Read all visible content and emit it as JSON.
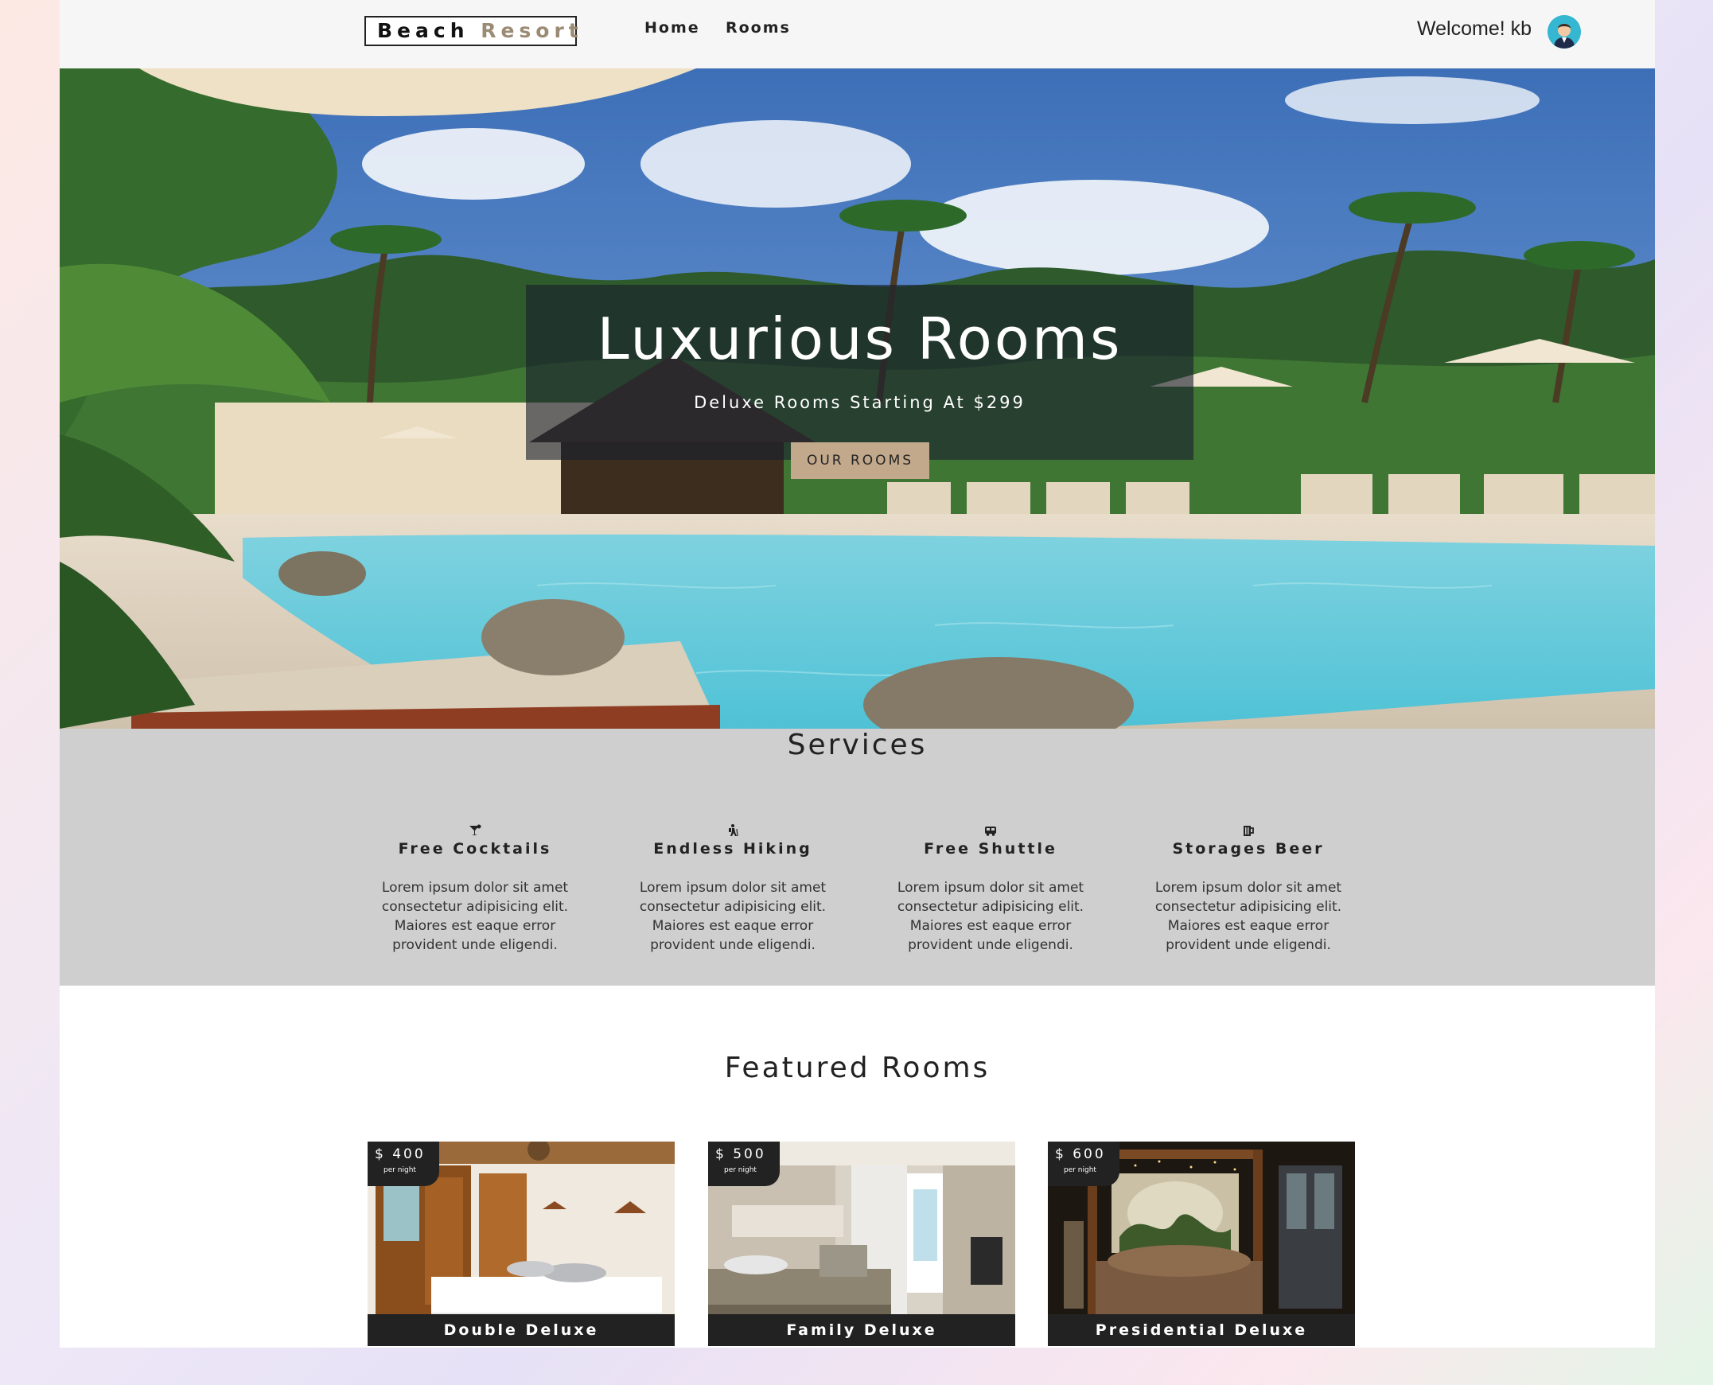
{
  "navbar": {
    "logo_main": "Beach ",
    "logo_accent": "Resort",
    "links": [
      "Home",
      "Rooms"
    ],
    "welcome": "Welcome! kb"
  },
  "hero": {
    "title": "Luxurious Rooms",
    "subtitle": "Deluxe Rooms Starting At $299",
    "button": "OUR ROOMS"
  },
  "services": {
    "title": "Services",
    "items": [
      {
        "icon": "cocktail-icon",
        "name": "Free Cocktails",
        "text": "Lorem ipsum dolor sit amet consectetur adipisicing elit. Maiores est eaque error provident unde eligendi."
      },
      {
        "icon": "hiking-icon",
        "name": "Endless Hiking",
        "text": "Lorem ipsum dolor sit amet consectetur adipisicing elit. Maiores est eaque error provident unde eligendi."
      },
      {
        "icon": "shuttle-icon",
        "name": "Free Shuttle",
        "text": "Lorem ipsum dolor sit amet consectetur adipisicing elit. Maiores est eaque error provident unde eligendi."
      },
      {
        "icon": "beer-icon",
        "name": "Storages Beer",
        "text": "Lorem ipsum dolor sit amet consectetur adipisicing elit. Maiores est eaque error provident unde eligendi."
      }
    ]
  },
  "featured": {
    "title": "Featured Rooms",
    "rooms": [
      {
        "price": "$ 400",
        "per": "per night",
        "name": "Double Deluxe"
      },
      {
        "price": "$ 500",
        "per": "per night",
        "name": "Family Deluxe"
      },
      {
        "price": "$ 600",
        "per": "per night",
        "name": "Presidential Deluxe"
      }
    ]
  },
  "colors": {
    "accent": "#c3a98c",
    "services_bg": "#cfcfcf",
    "dark": "#222222"
  }
}
